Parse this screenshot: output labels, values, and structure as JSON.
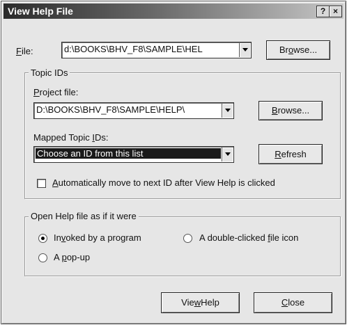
{
  "window": {
    "title": "View Help File",
    "help_button": "?",
    "close_button": "×"
  },
  "file": {
    "label_mnemonic": "F",
    "label_rest": "ile:",
    "value": "d:\\BOOKS\\BHV_F8\\SAMPLE\\HEL",
    "browse_pre": "Br",
    "browse_mnemonic": "o",
    "browse_post": "wse..."
  },
  "topic_ids": {
    "group_title": "Topic IDs",
    "project_label_pre": "",
    "project_label_mnemonic": "P",
    "project_label_post": "roject file:",
    "project_value": "D:\\BOOKS\\BHV_F8\\SAMPLE\\HELP\\",
    "browse_pre": "",
    "browse_mnemonic": "B",
    "browse_post": "rowse...",
    "mapped_label_pre": "Mapped Topic ",
    "mapped_label_mnemonic": "I",
    "mapped_label_post": "Ds:",
    "mapped_value": "Choose an ID from this list",
    "refresh_pre": "",
    "refresh_mnemonic": "R",
    "refresh_post": "efresh",
    "auto_move_pre": "",
    "auto_move_mnemonic": "A",
    "auto_move_post": "utomatically move to next ID after View Help is clicked",
    "auto_move_checked": false
  },
  "open_as": {
    "group_title": "Open Help file as if it were",
    "invoked_pre": "In",
    "invoked_mnemonic": "v",
    "invoked_post": "oked by a program",
    "invoked_selected": true,
    "double_pre": "A double-clicked ",
    "double_mnemonic": "f",
    "double_post": "ile icon",
    "popup_pre": "A ",
    "popup_mnemonic": "p",
    "popup_post": "op-up"
  },
  "buttons": {
    "view_pre": "Vie",
    "view_mnemonic": "w",
    "view_post": " Help",
    "close_pre": "",
    "close_mnemonic": "C",
    "close_post": "lose"
  }
}
